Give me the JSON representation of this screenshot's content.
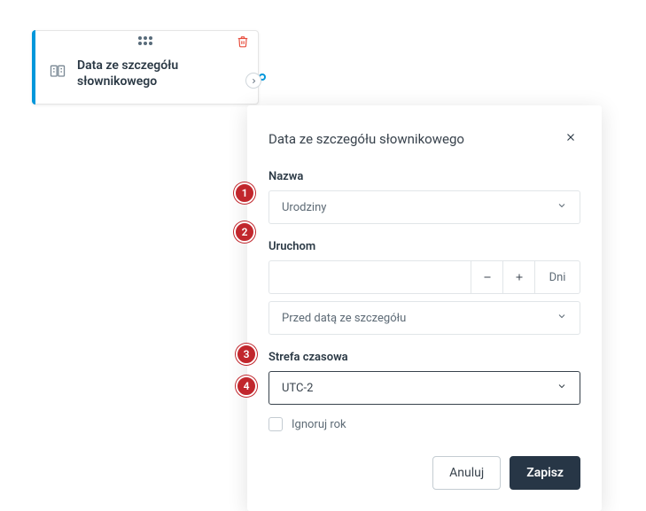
{
  "node": {
    "title": "Data ze szczegółu słownikowego"
  },
  "panel": {
    "title": "Data ze szczegółu słownikowego",
    "name": {
      "label": "Nazwa",
      "value": "Urodziny"
    },
    "run": {
      "label": "Uruchom",
      "unit": "Dni",
      "relative": "Przed datą ze szczegółu"
    },
    "tz": {
      "label": "Strefa czasowa",
      "value": "UTC-2"
    },
    "ignore_year": {
      "label": "Ignoruj rok"
    },
    "actions": {
      "cancel": "Anuluj",
      "save": "Zapisz"
    }
  },
  "badges": {
    "b1": "1",
    "b2": "2",
    "b3": "3",
    "b4": "4"
  }
}
